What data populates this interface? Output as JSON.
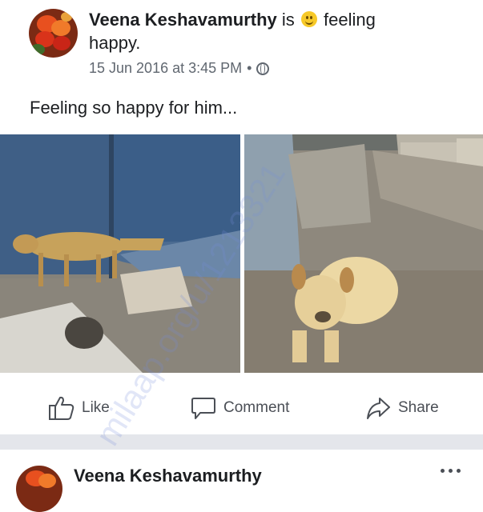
{
  "post": {
    "author": "Veena Keshavamurthy",
    "status_prefix": "is",
    "feeling": "feeling happy.",
    "timestamp": "15 Jun 2016 at 3:45 PM",
    "separator": "•",
    "privacy_icon": "globe-icon",
    "text": "Feeling so happy for him...",
    "photos": [
      "puppy-by-barrels-photo",
      "puppy-lying-photo"
    ]
  },
  "actions": {
    "like": "Like",
    "comment": "Comment",
    "share": "Share"
  },
  "next_post": {
    "author": "Veena Keshavamurthy"
  },
  "watermark": "milaap.org/u/1213321",
  "colors": {
    "text": "#1c1e21",
    "secondary": "#606770",
    "divider": "#e4e6eb",
    "emoji": "#f7c928"
  }
}
